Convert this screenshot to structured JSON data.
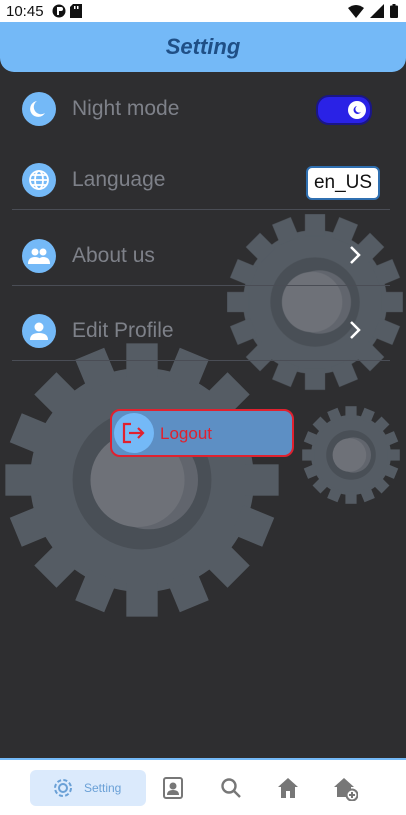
{
  "status": {
    "time": "10:45"
  },
  "header": {
    "title": "Setting"
  },
  "settings": {
    "night_mode": {
      "label": "Night mode",
      "enabled": true
    },
    "language": {
      "label": "Language",
      "value": "en_US"
    },
    "about": {
      "label": "About us"
    },
    "profile": {
      "label": "Edit Profile"
    }
  },
  "logout": {
    "label": "Logout"
  },
  "nav": {
    "active_label": "Setting",
    "items": [
      "settings-icon",
      "profile-card-icon",
      "search-icon",
      "home-icon",
      "home-add-icon"
    ]
  },
  "colors": {
    "background": "#2e2e30",
    "accent": "#74b9f7",
    "toggle": "#2a22e6",
    "logout_text": "#e0212f",
    "title_text": "#1f4f86"
  }
}
